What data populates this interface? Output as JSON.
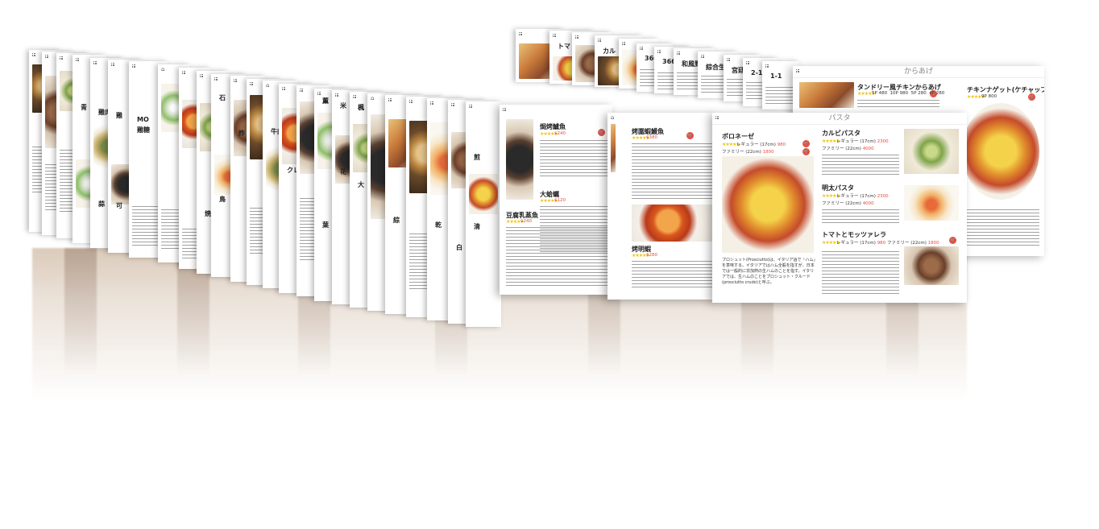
{
  "front_card": {
    "header": "パスタ",
    "left_dish": {
      "name": "ボロネーゼ",
      "regular_label": "レギュラー",
      "regular_size": "(17cm)",
      "regular_price": "980",
      "family_label": "ファミリー",
      "family_size": "(22cm)",
      "family_price": "1800",
      "description": "プロシュット(Prosciutto)は、イタリア語で「ハム」を意味する。イタリアではハム全般を指すが、日本では一般的に非加熱の生ハムのことを指す。イタリアでは、生ハムのことをプロシュット・クルード(prosciutto crudo)と呼ぶ。"
    },
    "dishes": [
      {
        "name": "カルビパスタ",
        "regular_label": "レギュラー",
        "regular_size": "(17cm)",
        "regular_price": "2300",
        "family_label": "ファミリー",
        "family_size": "(22cm)",
        "family_price": "4000"
      },
      {
        "name": "明太パスタ",
        "regular_label": "レギュラー",
        "regular_size": "(17cm)",
        "regular_price": "2300",
        "family_label": "ファミリー",
        "family_size": "(22cm)",
        "family_price": "4000"
      },
      {
        "name": "トマトとモッツァレラ",
        "regular_label": "レギュラー",
        "regular_size": "(17cm)",
        "regular_price": "980",
        "family_label": "ファミリー",
        "family_size": "(22cm)",
        "family_price": "1800"
      }
    ]
  },
  "karaage_card": {
    "header": "からあげ",
    "dishes": [
      {
        "name": "タンドリー風チキンからあげ",
        "prices": [
          "5P 480",
          "10P 980",
          "5P 280",
          "4P 280"
        ]
      },
      {
        "name": "チキンナゲット(ケチャップ)",
        "prices": [
          "9P 800"
        ]
      }
    ]
  },
  "chinese_card_1": {
    "dishes": [
      {
        "name": "焗烤鱸魚",
        "price": "$240"
      },
      {
        "name": "大蛤蠣",
        "price": "$120"
      },
      {
        "name": "豆腐乳蒸魚",
        "price": "$240"
      }
    ]
  },
  "chinese_card_2": {
    "dishes": [
      {
        "name": "烤圍蝦鰻魚",
        "price": "$380"
      },
      {
        "name": "烤明蝦",
        "price": "$280"
      }
    ]
  },
  "back_titles": {
    "t1": "トマト",
    "t2": "カル",
    "t3": "366",
    "t4": "366",
    "t5": "和風野",
    "t6": "綜合生",
    "t7": "宮廷",
    "t8": "2-1",
    "t9": "1-1",
    "t10": "MO",
    "t11": "雞糖",
    "t12": "青",
    "t13": "雞",
    "t14": "雞肉",
    "t15": "蒜",
    "t16": "石",
    "t17": "牛肉",
    "t18": "炸",
    "t19": "可",
    "t20": "綜合",
    "t21": "焼",
    "t22": "鳥",
    "t23": "クレ",
    "t24": "薫",
    "t25": "米",
    "t26": "楓",
    "t27": "花",
    "t28": "大",
    "t29": "葉",
    "t30": "綜",
    "t31": "乾",
    "t32": "清",
    "t33": "煎",
    "t34": "白"
  }
}
